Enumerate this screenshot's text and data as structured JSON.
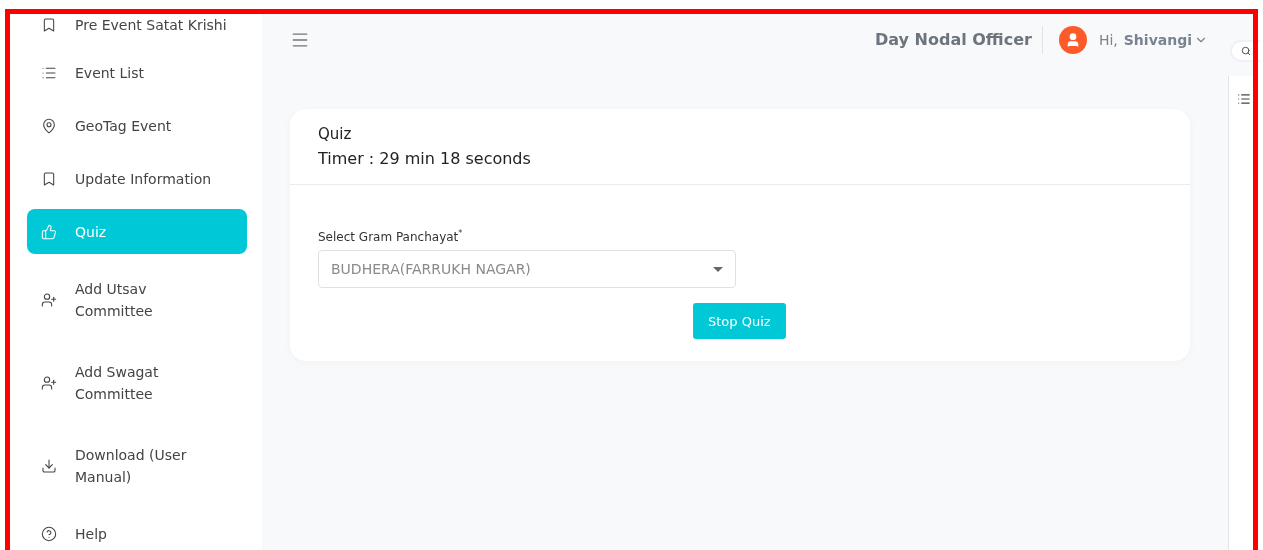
{
  "sidebar": {
    "items": [
      {
        "label": "Pre Event Satat Krishi",
        "selected": false
      },
      {
        "label": "Event List",
        "selected": false
      },
      {
        "label": "GeoTag Event",
        "selected": false
      },
      {
        "label": "Update Information",
        "selected": false
      },
      {
        "label": "Quiz",
        "selected": true
      },
      {
        "label": "Add Utsav Committee",
        "selected": false
      },
      {
        "label": "Add Swagat Committee",
        "selected": false
      },
      {
        "label": "Download (User Manual)",
        "selected": false
      },
      {
        "label": "Help",
        "selected": false
      }
    ]
  },
  "header": {
    "role": "Day Nodal Officer",
    "greeting": "Hi,",
    "user": "Shivangi"
  },
  "card": {
    "title": "Quiz",
    "timer": "Timer : 29 min 18 seconds",
    "field": {
      "label": "Select Gram Panchayat",
      "required_mark": "*",
      "value": "BUDHERA(FARRUKH NAGAR)"
    },
    "button": "Stop Quiz"
  }
}
